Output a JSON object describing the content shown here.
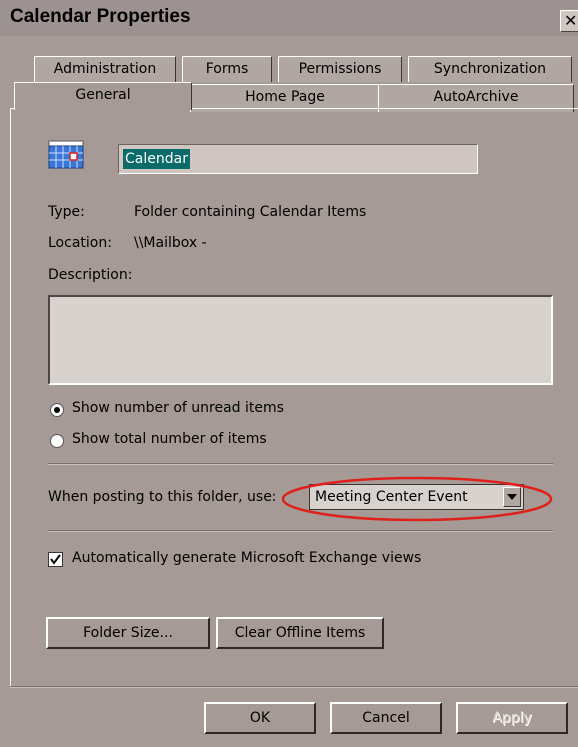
{
  "window": {
    "title": "Calendar Properties",
    "close_label": "✕"
  },
  "tabs": {
    "back_row": [
      {
        "label": "Administration"
      },
      {
        "label": "Forms"
      },
      {
        "label": "Permissions"
      },
      {
        "label": "Synchronization"
      }
    ],
    "front_row": [
      {
        "label": "General",
        "active": true
      },
      {
        "label": "Home Page"
      },
      {
        "label": "AutoArchive"
      }
    ]
  },
  "general": {
    "folder_icon": "calendar-icon",
    "name_value": "Calendar",
    "type_label": "Type:",
    "type_value": "Folder containing Calendar Items",
    "location_label": "Location:",
    "location_value": "\\\\Mailbox -",
    "description_label": "Description:",
    "description_value": "",
    "radio_unread_label": "Show number of unread items",
    "radio_unread_selected": true,
    "radio_total_label": "Show total number of items",
    "posting_label": "When posting to this folder, use:",
    "posting_form_value": "Meeting Center Event",
    "auto_views_label": "Automatically generate Microsoft Exchange views",
    "auto_views_checked": true,
    "folder_size_label": "Folder Size...",
    "clear_offline_label": "Clear Offline Items"
  },
  "footer": {
    "ok_label": "OK",
    "cancel_label": "Cancel",
    "apply_label": "Apply",
    "apply_enabled": false
  },
  "colors": {
    "dialog_bg": "#a59a95",
    "highlight_ellipse": "#e0201a",
    "selection": "#0b6b6b"
  }
}
